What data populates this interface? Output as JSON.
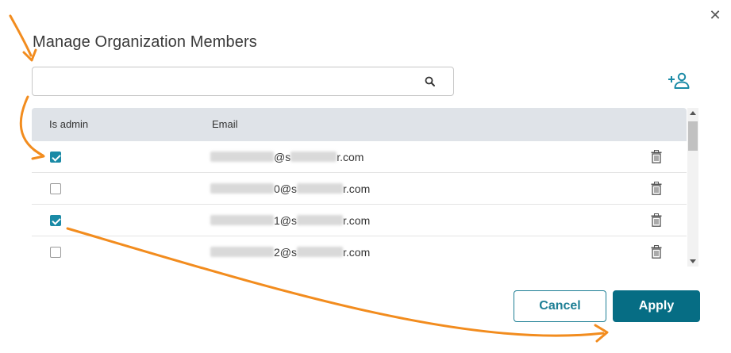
{
  "dialog": {
    "title": "Manage Organization Members",
    "close_icon": "close-icon",
    "close_glyph": "✕"
  },
  "search": {
    "value": "",
    "placeholder": "",
    "icon": "search-icon"
  },
  "add_member": {
    "icon": "add-user-icon"
  },
  "table": {
    "columns": [
      "Is admin",
      "Email"
    ],
    "rows": [
      {
        "is_admin": true,
        "email_visible_suffix": "@s",
        "email_domain_end": "r.com"
      },
      {
        "is_admin": false,
        "email_visible_suffix": "0@s",
        "email_domain_end": "r.com"
      },
      {
        "is_admin": true,
        "email_visible_suffix": "1@s",
        "email_domain_end": "r.com"
      },
      {
        "is_admin": false,
        "email_visible_suffix": "2@s",
        "email_domain_end": "r.com"
      }
    ],
    "row_action_icon": "trash-icon"
  },
  "footer": {
    "cancel_label": "Cancel",
    "apply_label": "Apply"
  },
  "colors": {
    "accent": "#066d84",
    "checkbox_checked": "#1a8aa6",
    "annotation_arrow": "#f28c1e",
    "header_bg": "#dfe3e8"
  }
}
